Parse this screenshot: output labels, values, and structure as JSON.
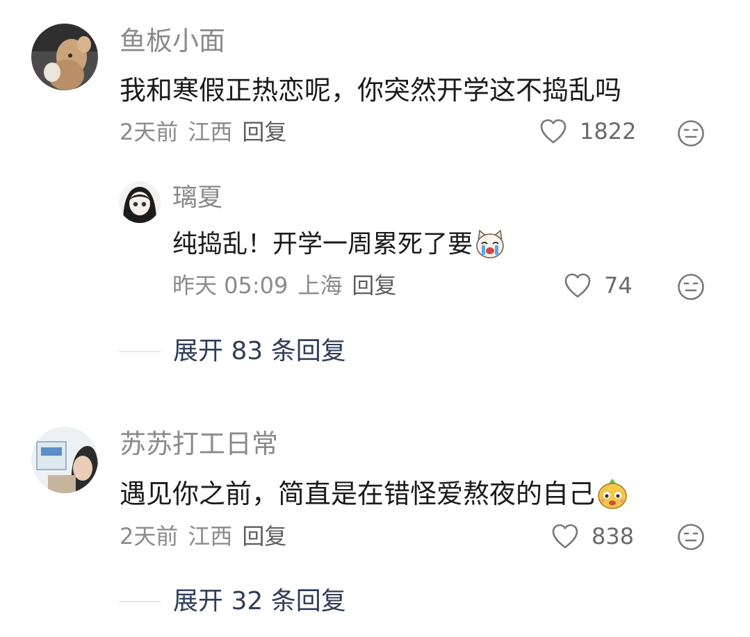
{
  "comments": [
    {
      "username": "鱼板小面",
      "text": "我和寒假正热恋呢，你突然开学这不捣乱吗",
      "time": "2天前",
      "location": "江西",
      "reply_label": "回复",
      "likes": "1822",
      "sub_reply": {
        "username": "璃夏",
        "text": "纯捣乱！开学一周累死了要",
        "emoji": "crying-dog-sticker",
        "time": "昨天 05:09",
        "location": "上海",
        "reply_label": "回复",
        "likes": "74"
      },
      "expand_label": "展开 83 条回复"
    },
    {
      "username": "苏苏打工日常",
      "text": "遇见你之前，简直是在错怪爱熬夜的自己",
      "emoji": "yellow-face-sticker",
      "time": "2天前",
      "location": "江西",
      "reply_label": "回复",
      "likes": "838",
      "expand_label": "展开 32 条回复"
    }
  ]
}
